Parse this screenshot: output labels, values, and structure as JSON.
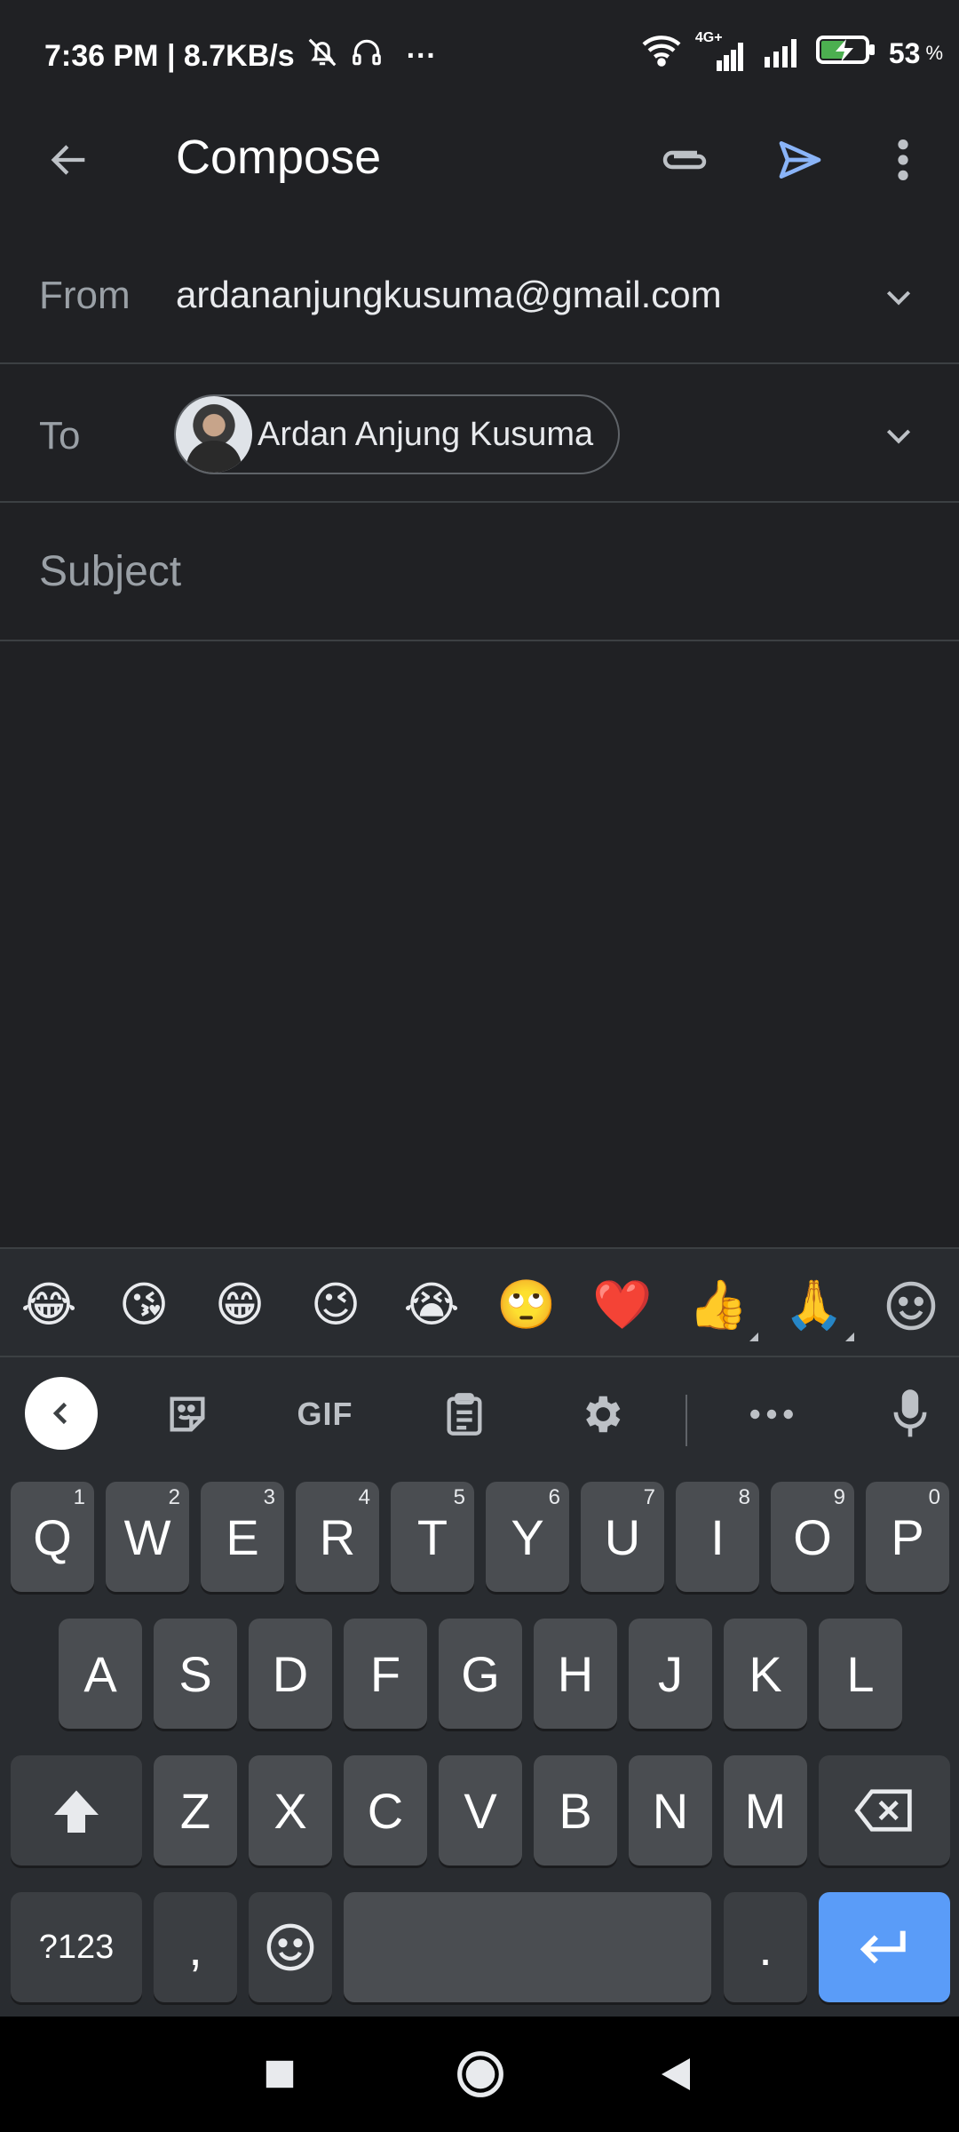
{
  "status_bar": {
    "time_speed": "7:36 PM | 8.7KB/s",
    "more": "···",
    "network_label": "4G+",
    "battery": "53",
    "battery_unit": "%"
  },
  "app_bar": {
    "title": "Compose",
    "send_color": "#8ab4f8"
  },
  "compose": {
    "from_label": "From",
    "from_value": "ardananjungkusuma@gmail.com",
    "to_label": "To",
    "recipient_name": "Ardan Anjung Kusuma",
    "subject_placeholder": "Subject",
    "body": ""
  },
  "keyboard": {
    "emoji_suggestions": [
      "😂",
      "😘",
      "😁",
      "😉",
      "😭",
      "🙄",
      "❤️",
      "👍",
      "🙏"
    ],
    "toolbar": {
      "gif_label": "GIF"
    },
    "rows": {
      "row1": [
        {
          "label": "Q",
          "hint": "1"
        },
        {
          "label": "W",
          "hint": "2"
        },
        {
          "label": "E",
          "hint": "3"
        },
        {
          "label": "R",
          "hint": "4"
        },
        {
          "label": "T",
          "hint": "5"
        },
        {
          "label": "Y",
          "hint": "6"
        },
        {
          "label": "U",
          "hint": "7"
        },
        {
          "label": "I",
          "hint": "8"
        },
        {
          "label": "O",
          "hint": "9"
        },
        {
          "label": "P",
          "hint": "0"
        }
      ],
      "row2": [
        "A",
        "S",
        "D",
        "F",
        "G",
        "H",
        "J",
        "K",
        "L"
      ],
      "row3": [
        "Z",
        "X",
        "C",
        "V",
        "B",
        "N",
        "M"
      ]
    },
    "symbols_label": "?123",
    "comma_label": ",",
    "period_label": ".",
    "enter_color": "#5a9cf8"
  }
}
